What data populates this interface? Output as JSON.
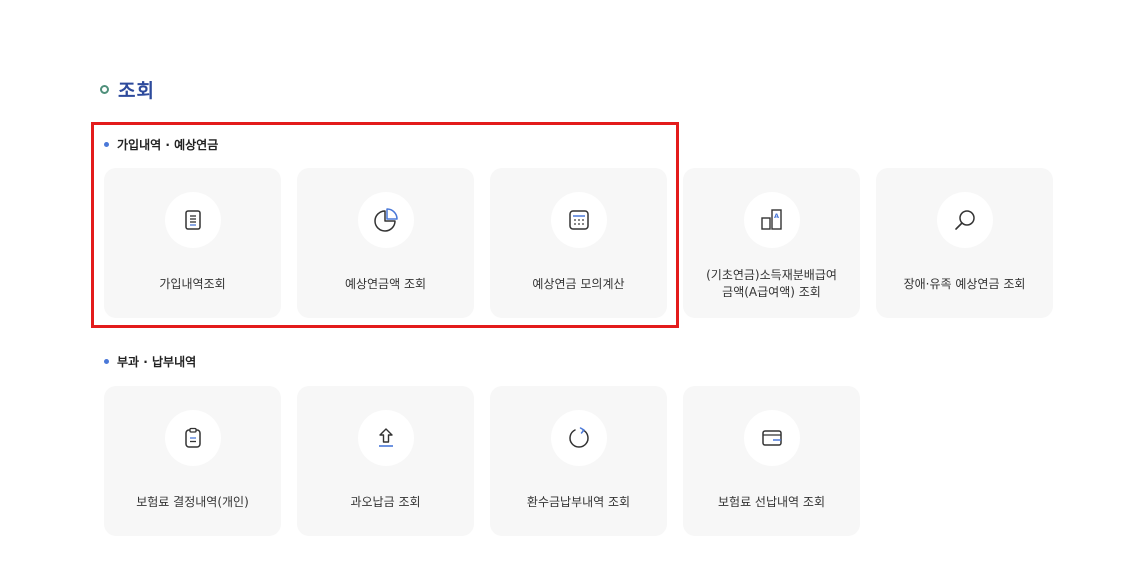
{
  "page": {
    "title": "조회"
  },
  "sections": [
    {
      "label": "가입내역 · 예상연금",
      "cards": [
        {
          "label": "가입내역조회",
          "icon": "document-lines-icon"
        },
        {
          "label": "예상연금액 조회",
          "icon": "pie-chart-icon"
        },
        {
          "label": "예상연금 모의계산",
          "icon": "calculator-icon"
        },
        {
          "label": "(기초연금)소득재분배급여\n금액(A급여액) 조회",
          "icon": "compare-boxes-icon"
        },
        {
          "label": "장애·유족 예상연금 조회",
          "icon": "search-icon"
        }
      ]
    },
    {
      "label": "부과 · 납부내역",
      "cards": [
        {
          "label": "보험료 결정내역(개인)",
          "icon": "clipboard-icon"
        },
        {
          "label": "과오납금 조회",
          "icon": "upload-arrow-icon"
        },
        {
          "label": "환수금납부내역 조회",
          "icon": "refresh-icon"
        },
        {
          "label": "보험료 선납내역 조회",
          "icon": "wallet-icon"
        }
      ]
    }
  ],
  "colors": {
    "title": "#2d4a9c",
    "title_ring": "#4e8f7a",
    "bullet": "#4a78d8",
    "icon_accent": "#4a78d8",
    "icon_stroke": "#333333",
    "card_bg": "#f7f7f7",
    "highlight": "#e31b1b"
  }
}
